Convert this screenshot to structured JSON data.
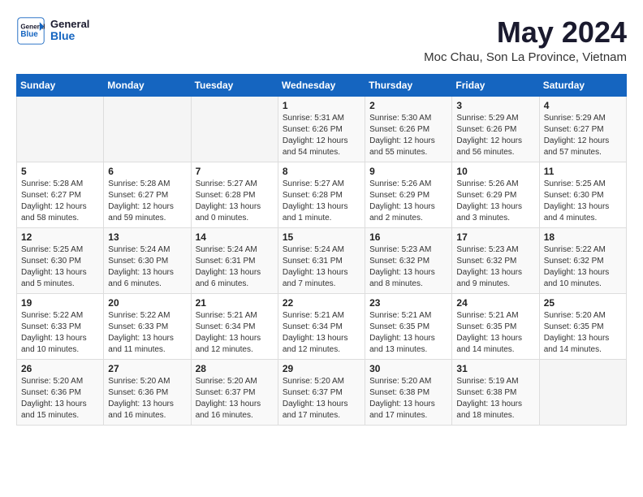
{
  "header": {
    "logo_general": "General",
    "logo_blue": "Blue",
    "month_title": "May 2024",
    "location": "Moc Chau, Son La Province, Vietnam"
  },
  "days_of_week": [
    "Sunday",
    "Monday",
    "Tuesday",
    "Wednesday",
    "Thursday",
    "Friday",
    "Saturday"
  ],
  "weeks": [
    [
      {
        "day": "",
        "info": ""
      },
      {
        "day": "",
        "info": ""
      },
      {
        "day": "",
        "info": ""
      },
      {
        "day": "1",
        "info": "Sunrise: 5:31 AM\nSunset: 6:26 PM\nDaylight: 12 hours\nand 54 minutes."
      },
      {
        "day": "2",
        "info": "Sunrise: 5:30 AM\nSunset: 6:26 PM\nDaylight: 12 hours\nand 55 minutes."
      },
      {
        "day": "3",
        "info": "Sunrise: 5:29 AM\nSunset: 6:26 PM\nDaylight: 12 hours\nand 56 minutes."
      },
      {
        "day": "4",
        "info": "Sunrise: 5:29 AM\nSunset: 6:27 PM\nDaylight: 12 hours\nand 57 minutes."
      }
    ],
    [
      {
        "day": "5",
        "info": "Sunrise: 5:28 AM\nSunset: 6:27 PM\nDaylight: 12 hours\nand 58 minutes."
      },
      {
        "day": "6",
        "info": "Sunrise: 5:28 AM\nSunset: 6:27 PM\nDaylight: 12 hours\nand 59 minutes."
      },
      {
        "day": "7",
        "info": "Sunrise: 5:27 AM\nSunset: 6:28 PM\nDaylight: 13 hours\nand 0 minutes."
      },
      {
        "day": "8",
        "info": "Sunrise: 5:27 AM\nSunset: 6:28 PM\nDaylight: 13 hours\nand 1 minute."
      },
      {
        "day": "9",
        "info": "Sunrise: 5:26 AM\nSunset: 6:29 PM\nDaylight: 13 hours\nand 2 minutes."
      },
      {
        "day": "10",
        "info": "Sunrise: 5:26 AM\nSunset: 6:29 PM\nDaylight: 13 hours\nand 3 minutes."
      },
      {
        "day": "11",
        "info": "Sunrise: 5:25 AM\nSunset: 6:30 PM\nDaylight: 13 hours\nand 4 minutes."
      }
    ],
    [
      {
        "day": "12",
        "info": "Sunrise: 5:25 AM\nSunset: 6:30 PM\nDaylight: 13 hours\nand 5 minutes."
      },
      {
        "day": "13",
        "info": "Sunrise: 5:24 AM\nSunset: 6:30 PM\nDaylight: 13 hours\nand 6 minutes."
      },
      {
        "day": "14",
        "info": "Sunrise: 5:24 AM\nSunset: 6:31 PM\nDaylight: 13 hours\nand 6 minutes."
      },
      {
        "day": "15",
        "info": "Sunrise: 5:24 AM\nSunset: 6:31 PM\nDaylight: 13 hours\nand 7 minutes."
      },
      {
        "day": "16",
        "info": "Sunrise: 5:23 AM\nSunset: 6:32 PM\nDaylight: 13 hours\nand 8 minutes."
      },
      {
        "day": "17",
        "info": "Sunrise: 5:23 AM\nSunset: 6:32 PM\nDaylight: 13 hours\nand 9 minutes."
      },
      {
        "day": "18",
        "info": "Sunrise: 5:22 AM\nSunset: 6:32 PM\nDaylight: 13 hours\nand 10 minutes."
      }
    ],
    [
      {
        "day": "19",
        "info": "Sunrise: 5:22 AM\nSunset: 6:33 PM\nDaylight: 13 hours\nand 10 minutes."
      },
      {
        "day": "20",
        "info": "Sunrise: 5:22 AM\nSunset: 6:33 PM\nDaylight: 13 hours\nand 11 minutes."
      },
      {
        "day": "21",
        "info": "Sunrise: 5:21 AM\nSunset: 6:34 PM\nDaylight: 13 hours\nand 12 minutes."
      },
      {
        "day": "22",
        "info": "Sunrise: 5:21 AM\nSunset: 6:34 PM\nDaylight: 13 hours\nand 12 minutes."
      },
      {
        "day": "23",
        "info": "Sunrise: 5:21 AM\nSunset: 6:35 PM\nDaylight: 13 hours\nand 13 minutes."
      },
      {
        "day": "24",
        "info": "Sunrise: 5:21 AM\nSunset: 6:35 PM\nDaylight: 13 hours\nand 14 minutes."
      },
      {
        "day": "25",
        "info": "Sunrise: 5:20 AM\nSunset: 6:35 PM\nDaylight: 13 hours\nand 14 minutes."
      }
    ],
    [
      {
        "day": "26",
        "info": "Sunrise: 5:20 AM\nSunset: 6:36 PM\nDaylight: 13 hours\nand 15 minutes."
      },
      {
        "day": "27",
        "info": "Sunrise: 5:20 AM\nSunset: 6:36 PM\nDaylight: 13 hours\nand 16 minutes."
      },
      {
        "day": "28",
        "info": "Sunrise: 5:20 AM\nSunset: 6:37 PM\nDaylight: 13 hours\nand 16 minutes."
      },
      {
        "day": "29",
        "info": "Sunrise: 5:20 AM\nSunset: 6:37 PM\nDaylight: 13 hours\nand 17 minutes."
      },
      {
        "day": "30",
        "info": "Sunrise: 5:20 AM\nSunset: 6:38 PM\nDaylight: 13 hours\nand 17 minutes."
      },
      {
        "day": "31",
        "info": "Sunrise: 5:19 AM\nSunset: 6:38 PM\nDaylight: 13 hours\nand 18 minutes."
      },
      {
        "day": "",
        "info": ""
      }
    ]
  ]
}
